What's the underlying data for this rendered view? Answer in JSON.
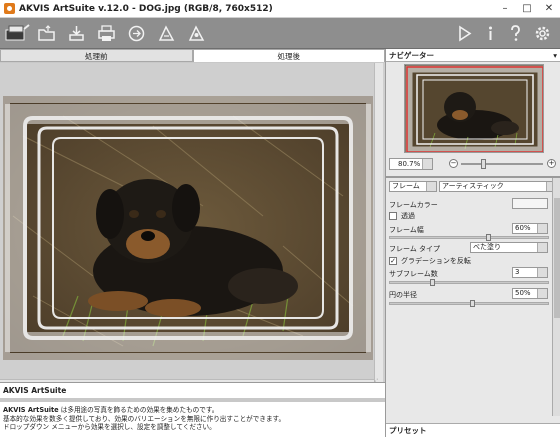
{
  "window": {
    "title": "AKVIS ArtSuite v.12.0 - DOG.jpg (RGB/8, 760x512)",
    "minimize": "–",
    "maximize": "□",
    "close": "✕"
  },
  "toolbar": {
    "left_icons": [
      "effects-icon",
      "open-icon",
      "save-icon",
      "print-icon",
      "share-icon",
      "undo-icon",
      "redo-icon"
    ],
    "right_icons": [
      "run-icon",
      "info-icon",
      "help-icon",
      "settings-gear-icon"
    ]
  },
  "tabs": [
    {
      "label": "処理前",
      "active": false
    },
    {
      "label": "処理後",
      "active": true
    }
  ],
  "help": {
    "title": "AKVIS ArtSuite",
    "line1_bold": "AKVIS ArtSuite",
    "line1": " は多用途の写真を飾るための効果を集めたものです。",
    "line2": "基本的な効果を数多く提供しており、効果のバリエーションを無限に作り出すことができます。",
    "line3": "ドロップダウン メニューから効果を選択し、設定を調整してください。"
  },
  "navigator": {
    "header": "ナビゲーター",
    "collapse": "▾",
    "zoom": "80.7%",
    "zoom_minus": "−",
    "zoom_plus": "+",
    "zoom_level": 0.35
  },
  "settings": {
    "category": "フレーム",
    "preset": "アーティスティック",
    "frame_color_label": "フレームカラー",
    "transparent_label": "透過",
    "transparent_checked": false,
    "frame_width_label": "フレーム幅",
    "frame_width_value": "60%",
    "frame_width_level": 0.6,
    "frame_type_label": "フレーム タイプ",
    "frame_type_value": "べた塗り",
    "invert_gradient_label": "グラデーションを反転",
    "invert_gradient_checked": true,
    "subframes_label": "サブフレーム数",
    "subframes_value": "3",
    "subframes_level": 0.25,
    "radius_label": "円の半径",
    "radius_value": "50%",
    "radius_level": 0.5
  },
  "presets": {
    "header": "プリセット"
  },
  "colors": {
    "toolbar": "#8e8e8e",
    "frame_color": "#f5f5f5"
  }
}
